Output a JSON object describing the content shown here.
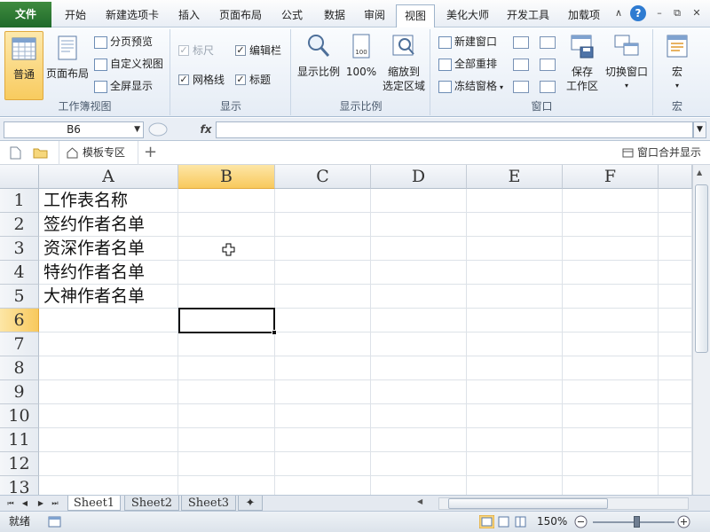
{
  "tabs": {
    "file": "文件",
    "items": [
      "开始",
      "新建选项卡",
      "插入",
      "页面布局",
      "公式",
      "数据",
      "审阅",
      "视图",
      "美化大师",
      "开发工具",
      "加载项"
    ],
    "active": "视图"
  },
  "ribbon": {
    "workbook_views": {
      "label": "工作簿视图",
      "normal": "普通",
      "page_layout": "页面布局",
      "page_break_preview": "分页预览",
      "custom_views": "自定义视图",
      "full_screen": "全屏显示"
    },
    "show": {
      "label": "显示",
      "ruler": {
        "label": "标尺",
        "checked": true,
        "enabled": false
      },
      "formula_bar": {
        "label": "编辑栏",
        "checked": true,
        "enabled": true
      },
      "gridlines": {
        "label": "网格线",
        "checked": true,
        "enabled": true
      },
      "headings": {
        "label": "标题",
        "checked": true,
        "enabled": true
      }
    },
    "zoom": {
      "label": "显示比例",
      "zoom": "显示比例",
      "hundred": "100%",
      "zoom_selection_1": "缩放到",
      "zoom_selection_2": "选定区域"
    },
    "window": {
      "label": "窗口",
      "new_window": "新建窗口",
      "arrange_all": "全部重排",
      "freeze_panes": "冻结窗格",
      "save_workspace_1": "保存",
      "save_workspace_2": "工作区",
      "switch_windows": "切换窗口"
    },
    "macros": {
      "label": "宏",
      "macros": "宏"
    }
  },
  "formula_bar": {
    "name_box": "B6",
    "fx": "fx",
    "content": ""
  },
  "doc_tabs": {
    "template_tab": "模板专区",
    "merge_display": "窗口合并显示"
  },
  "grid": {
    "columns": [
      "A",
      "B",
      "C",
      "D",
      "E",
      "F"
    ],
    "rows": [
      "1",
      "2",
      "3",
      "4",
      "5",
      "6",
      "7",
      "8",
      "9",
      "10",
      "11",
      "12",
      "13"
    ],
    "selected_column": "B",
    "selected_row": "6",
    "cells": {
      "A1": "工作表名称",
      "A2": "签约作者名单",
      "A3": "资深作者名单",
      "A4": "特约作者名单",
      "A5": "大神作者名单"
    }
  },
  "sheets": {
    "tabs": [
      "Sheet1",
      "Sheet2",
      "Sheet3"
    ],
    "active": "Sheet1"
  },
  "status": {
    "mode": "就绪",
    "zoom": "150%"
  },
  "colors": {
    "file_tab": "#2a7a34",
    "selection_header": "#f8c95d",
    "accent_blue": "#2e7bd1"
  }
}
